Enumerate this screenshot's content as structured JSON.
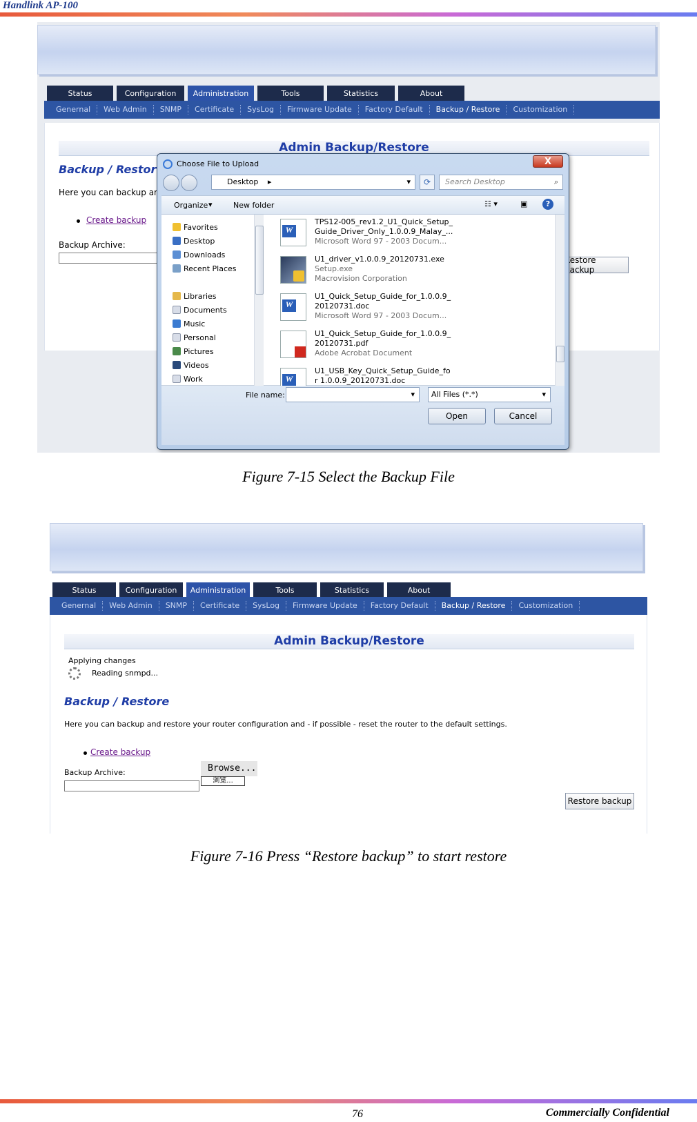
{
  "header": {
    "doc_title": "Handlink AP-100"
  },
  "footer": {
    "page": "76",
    "confidential": "Commercially Confidential"
  },
  "ui": {
    "tabs": [
      "Status",
      "Configuration",
      "Administration",
      "Tools",
      "Statistics",
      "About"
    ],
    "subnav": [
      "Genernal",
      "Web Admin",
      "SNMP",
      "Certificate",
      "SysLog",
      "Firmware Update",
      "Factory Default",
      "Backup / Restore",
      "Customization"
    ],
    "section_title": "Admin Backup/Restore",
    "heading": "Backup / Restore",
    "description_short": "Here you can backup an",
    "description": "Here you can backup and restore your router configuration and - if possible - reset the router to the default settings.",
    "create_backup": "Create backup",
    "archive_label": "Backup Archive:",
    "restore_button": "Restore backup"
  },
  "dialog": {
    "title": "Choose File to Upload",
    "close": "X",
    "address": "Desktop",
    "search_placeholder": "Search Desktop",
    "organize": "Organize",
    "new_folder": "New folder",
    "nav": [
      "Favorites",
      "Desktop",
      "Downloads",
      "Recent Places",
      "Libraries",
      "Documents",
      "Music",
      "Personal",
      "Pictures",
      "Videos",
      "Work"
    ],
    "files": [
      {
        "l1": "TPS12-005_rev1.2_U1_Quick_Setup_",
        "l2": "Guide_Driver_Only_1.0.0.9_Malay_...",
        "l3": "Microsoft Word 97 - 2003 Docum...",
        "kind": "word"
      },
      {
        "l1": "U1_driver_v1.0.0.9_20120731.exe",
        "l2": "Setup.exe",
        "l3": "Macrovision Corporation",
        "kind": "exe"
      },
      {
        "l1": "U1_Quick_Setup_Guide_for_1.0.0.9_",
        "l2": "20120731.doc",
        "l3": "Microsoft Word 97 - 2003 Docum...",
        "kind": "word"
      },
      {
        "l1": "U1_Quick_Setup_Guide_for_1.0.0.9_",
        "l2": "20120731.pdf",
        "l3": "Adobe Acrobat Document",
        "kind": "pdf"
      },
      {
        "l1": "U1_USB_Key_Quick_Setup_Guide_fo",
        "l2": "r 1.0.0.9_20120731.doc",
        "l3": "",
        "kind": "word"
      }
    ],
    "filename_label": "File name:",
    "filter": "All Files (*.*)",
    "open": "Open",
    "cancel": "Cancel"
  },
  "figure2": {
    "applying": "Applying changes",
    "reading": "Reading snmpd...",
    "browse": "Browse...",
    "browse_cn": "浏览..."
  },
  "captions": {
    "fig15": "Figure 7-15 Select the Backup File",
    "fig16": "Figure 7-16 Press “Restore backup” to start restore"
  },
  "colors": {
    "nav_dark": "#1d2b4b",
    "nav_active": "#2d53a8",
    "subnav": "#2d55a3",
    "heading": "#1f3da6",
    "link": "#6b1b8c"
  }
}
